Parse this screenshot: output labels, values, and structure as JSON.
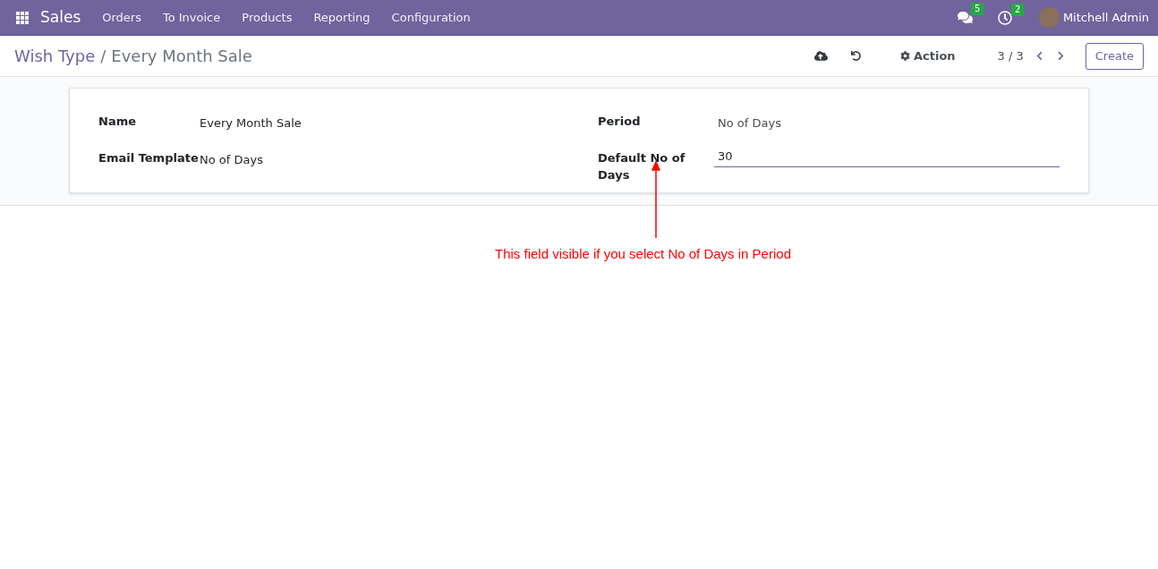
{
  "navbar": {
    "app": "Sales",
    "menu": [
      "Orders",
      "To Invoice",
      "Products",
      "Reporting",
      "Configuration"
    ],
    "messages_count": "5",
    "activities_count": "2",
    "user": "Mitchell Admin"
  },
  "breadcrumb": {
    "parent": "Wish Type",
    "separator": "/",
    "current": "Every Month Sale"
  },
  "control_panel": {
    "action": "Action",
    "pager": "3 / 3",
    "create": "Create"
  },
  "form": {
    "left": [
      {
        "label": "Name",
        "value": "Every Month Sale",
        "kind": "text"
      },
      {
        "label": "Email Template",
        "value": "No of Days",
        "kind": "text"
      }
    ],
    "right": [
      {
        "label": "Period",
        "value": "No of Days",
        "kind": "readonly"
      },
      {
        "label": "Default No of Days",
        "value": "30",
        "kind": "input"
      }
    ]
  },
  "annotation": {
    "text": "This field visible if you select No of Days in Period"
  }
}
